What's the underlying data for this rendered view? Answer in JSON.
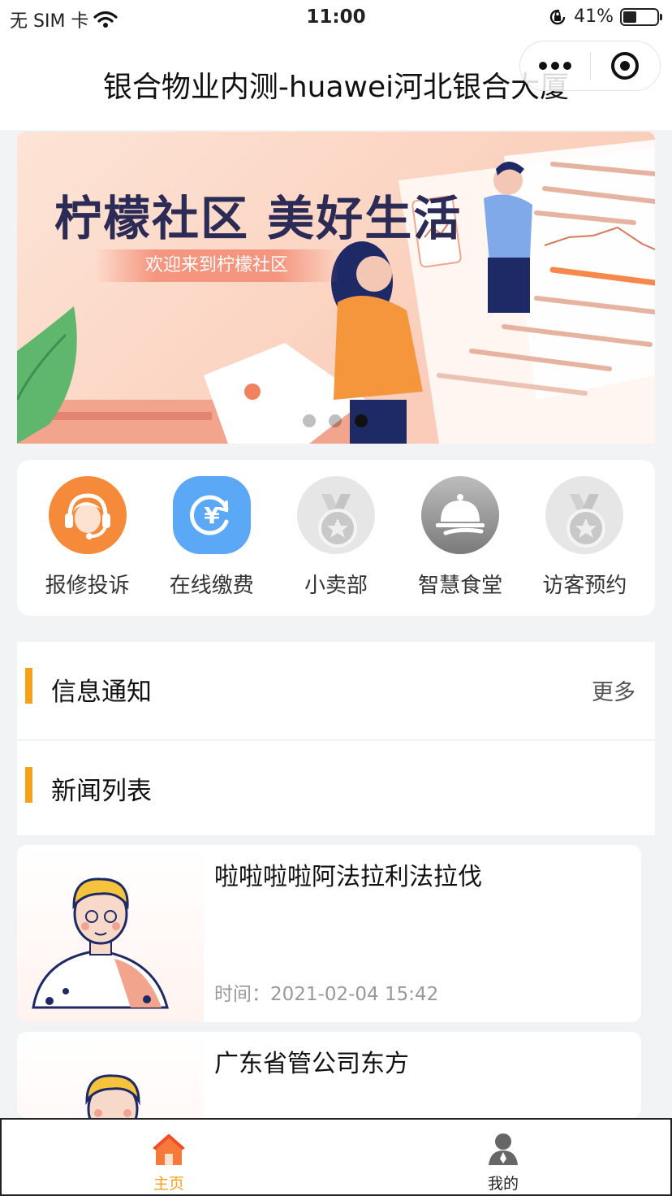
{
  "status_bar": {
    "carrier": "无 SIM 卡",
    "time": "11:00",
    "battery_text": "41%",
    "battery_level": 0.41
  },
  "nav": {
    "title": "银合物业内测-huawei河北银合大厦"
  },
  "banner": {
    "title": "柠檬社区  美好生活",
    "subtitle": "欢迎来到柠檬社区",
    "page_count": 3,
    "active_page": 3
  },
  "quick_menu": [
    {
      "label": "报修投诉",
      "icon": "customer-service-icon",
      "color": "#f58a3a"
    },
    {
      "label": "在线缴费",
      "icon": "yuan-payment-icon",
      "color": "#5aa8f6"
    },
    {
      "label": "小卖部",
      "icon": "medal-icon",
      "color": "#d8d8d8"
    },
    {
      "label": "智慧食堂",
      "icon": "dining-cloche-icon",
      "color": "#9a9a9a"
    },
    {
      "label": "访客预约",
      "icon": "medal-icon",
      "color": "#d8d8d8"
    }
  ],
  "sections": {
    "notice": {
      "title": "信息通知",
      "more": "更多"
    },
    "news": {
      "title": "新闻列表"
    }
  },
  "news": [
    {
      "title": "啦啦啦啦阿法拉利法拉伐",
      "time": "时间：2021-02-04 15:42"
    },
    {
      "title": "广东省管公司东方",
      "time": ""
    }
  ],
  "tabs": [
    {
      "label": "主页",
      "icon": "home-icon",
      "active": true
    },
    {
      "label": "我的",
      "icon": "user-icon",
      "active": false
    }
  ],
  "colors": {
    "accent": "#f6a11a",
    "tab_active": "#f6a11a",
    "banner_text": "#2b2b55"
  }
}
